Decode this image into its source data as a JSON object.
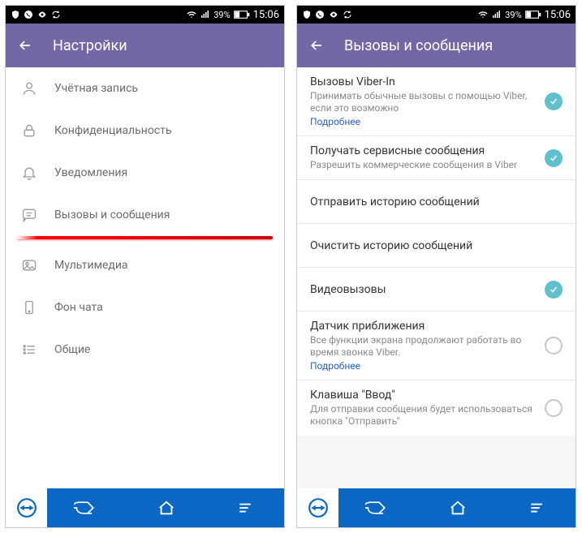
{
  "status": {
    "battery_text": "39%",
    "time": "15:06"
  },
  "left": {
    "title": "Настройки",
    "items": [
      {
        "label": "Учётная запись"
      },
      {
        "label": "Конфиденциальность"
      },
      {
        "label": "Уведомления"
      },
      {
        "label": "Вызовы и сообщения"
      },
      {
        "label": "Мультимедиа"
      },
      {
        "label": "Фон чата"
      },
      {
        "label": "Общие"
      }
    ]
  },
  "right": {
    "title": "Вызовы и сообщения",
    "rows": {
      "viber_in": {
        "title": "Вызовы Viber-In",
        "sub": "Принимать обычные вызовы с помощью Viber, если это возможно",
        "link": "Подробнее"
      },
      "service_msgs": {
        "title": "Получать сервисные сообщения",
        "sub": "Разрешить коммерческие сообщения в Viber"
      },
      "send_history": {
        "title": "Отправить историю сообщений"
      },
      "clear_history": {
        "title": "Очистить историю сообщений"
      },
      "video_calls": {
        "title": "Видеовызовы"
      },
      "proximity": {
        "title": "Датчик приближения",
        "sub": "Все функции экрана продолжают работать во время звонка Viber.",
        "link": "Подробнее"
      },
      "enter_key": {
        "title": "Клавиша \"Ввод\"",
        "sub": "Для отправки сообщения будет использоваться кнопка \"Отправить\""
      }
    }
  }
}
